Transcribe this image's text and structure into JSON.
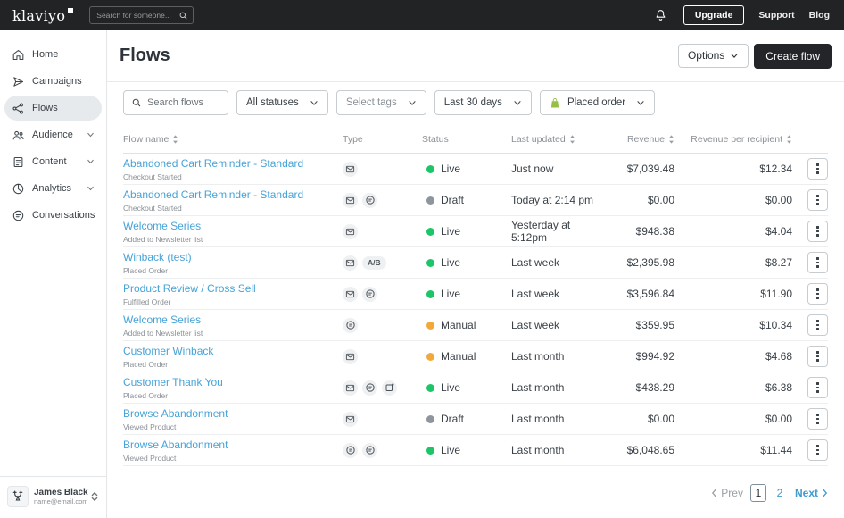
{
  "topbar": {
    "logo": "klaviyo",
    "search_placeholder": "Search for someone...",
    "upgrade_label": "Upgrade",
    "support_label": "Support",
    "blog_label": "Blog"
  },
  "sidebar": {
    "items": [
      {
        "label": "Home",
        "icon": "home-icon",
        "active": false,
        "chevron": false
      },
      {
        "label": "Campaigns",
        "icon": "campaigns-icon",
        "active": false,
        "chevron": false
      },
      {
        "label": "Flows",
        "icon": "flows-icon",
        "active": true,
        "chevron": false
      },
      {
        "label": "Audience",
        "icon": "audience-icon",
        "active": false,
        "chevron": true
      },
      {
        "label": "Content",
        "icon": "content-icon",
        "active": false,
        "chevron": true
      },
      {
        "label": "Analytics",
        "icon": "analytics-icon",
        "active": false,
        "chevron": true
      },
      {
        "label": "Conversations",
        "icon": "conversations-icon",
        "active": false,
        "chevron": false
      }
    ],
    "user": {
      "name": "James Black",
      "email": "name@email.com"
    }
  },
  "header": {
    "title": "Flows",
    "options_label": "Options",
    "create_label": "Create flow"
  },
  "filters": {
    "search_placeholder": "Search flows",
    "status_filter": "All statuses",
    "tags_filter": "Select tags",
    "date_filter": "Last 30 days",
    "integration_filter": "Placed order"
  },
  "table": {
    "columns": [
      {
        "label": "Flow name",
        "sortable": true,
        "align": "left"
      },
      {
        "label": "Type",
        "sortable": false,
        "align": "left"
      },
      {
        "label": "Status",
        "sortable": false,
        "align": "left"
      },
      {
        "label": "Last updated",
        "sortable": true,
        "align": "left"
      },
      {
        "label": "Revenue",
        "sortable": true,
        "align": "right"
      },
      {
        "label": "Revenue per recipient",
        "sortable": true,
        "align": "right"
      }
    ],
    "rows": [
      {
        "name": "Abandoned Cart Reminder - Standard",
        "trigger": "Checkout Started",
        "types": [
          "email"
        ],
        "ab": false,
        "status": "Live",
        "last_updated": "Just now",
        "revenue": "$7,039.48",
        "revenue_per_recipient": "$12.34"
      },
      {
        "name": "Abandoned Cart Reminder - Standard",
        "trigger": "Checkout Started",
        "types": [
          "email",
          "sms"
        ],
        "ab": false,
        "status": "Draft",
        "last_updated": "Today at 2:14 pm",
        "revenue": "$0.00",
        "revenue_per_recipient": "$0.00"
      },
      {
        "name": "Welcome Series",
        "trigger": "Added to Newsletter list",
        "types": [
          "email"
        ],
        "ab": false,
        "status": "Live",
        "last_updated": "Yesterday at 5:12pm",
        "revenue": "$948.38",
        "revenue_per_recipient": "$4.04"
      },
      {
        "name": "Winback (test)",
        "trigger": "Placed Order",
        "types": [
          "email"
        ],
        "ab": true,
        "status": "Live",
        "last_updated": "Last week",
        "revenue": "$2,395.98",
        "revenue_per_recipient": "$8.27"
      },
      {
        "name": "Product Review / Cross Sell",
        "trigger": "Fulfilled Order",
        "types": [
          "email",
          "sms"
        ],
        "ab": false,
        "status": "Live",
        "last_updated": "Last week",
        "revenue": "$3,596.84",
        "revenue_per_recipient": "$11.90"
      },
      {
        "name": "Welcome Series",
        "trigger": "Added to Newsletter list",
        "types": [
          "sms"
        ],
        "ab": false,
        "status": "Manual",
        "last_updated": "Last week",
        "revenue": "$359.95",
        "revenue_per_recipient": "$10.34"
      },
      {
        "name": "Customer Winback",
        "trigger": "Placed Order",
        "types": [
          "email"
        ],
        "ab": false,
        "status": "Manual",
        "last_updated": "Last month",
        "revenue": "$994.92",
        "revenue_per_recipient": "$4.68"
      },
      {
        "name": "Customer Thank You",
        "trigger": "Placed Order",
        "types": [
          "email",
          "sms",
          "push"
        ],
        "ab": false,
        "status": "Live",
        "last_updated": "Last month",
        "revenue": "$438.29",
        "revenue_per_recipient": "$6.38"
      },
      {
        "name": "Browse Abandonment",
        "trigger": "Viewed Product",
        "types": [
          "email"
        ],
        "ab": false,
        "status": "Draft",
        "last_updated": "Last month",
        "revenue": "$0.00",
        "revenue_per_recipient": "$0.00"
      },
      {
        "name": "Browse Abandonment",
        "trigger": "Viewed Product",
        "types": [
          "sms",
          "sms"
        ],
        "ab": false,
        "status": "Live",
        "last_updated": "Last month",
        "revenue": "$6,048.65",
        "revenue_per_recipient": "$11.44"
      }
    ]
  },
  "pagination": {
    "prev_label": "Prev",
    "pages": [
      "1",
      "2"
    ],
    "current_page": "1",
    "next_label": "Next"
  },
  "colors": {
    "topbar_bg": "#222325",
    "link_blue": "#47a3d8",
    "pagination_blue": "#3d9bd0",
    "dark_button_bg": "#232528",
    "shopify_green": "#95bf47",
    "status": {
      "Live": "#1dc468",
      "Draft": "#8e959c",
      "Manual": "#f2a93b"
    }
  }
}
